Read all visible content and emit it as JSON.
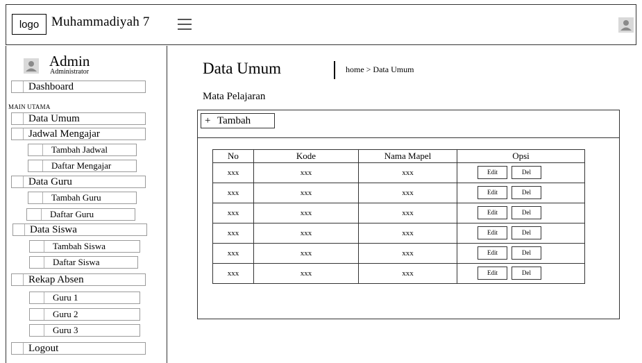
{
  "header": {
    "logo_label": "logo",
    "school_name": "Muhammadiyah 7",
    "menu_icon": "hamburger-icon",
    "user_icon": "user-icon"
  },
  "sidebar": {
    "user": {
      "name": "Admin",
      "role": "Administrator",
      "icon": "user-icon"
    },
    "dashboard": "Dashboard",
    "section_label": "MAIN UTAMA",
    "data_umum": "Data Umum",
    "jadwal_mengajar": "Jadwal Mengajar",
    "tambah_jadwal": "Tambah Jadwal",
    "daftar_mengajar": "Daftar Mengajar",
    "data_guru": "Data Guru",
    "tambah_guru": "Tambah Guru",
    "daftar_guru": "Daftar Guru",
    "data_siswa": "Data Siswa",
    "tambah_siswa": "Tambah Siswa",
    "daftar_siswa": "Daftar Siswa",
    "rekap_absen": "Rekap Absen",
    "guru_1": "Guru 1",
    "guru_2": "Guru 2",
    "guru_3": "Guru 3",
    "logout": "Logout"
  },
  "main": {
    "title": "Data Umum",
    "breadcrumb": "home > Data Umum",
    "subtitle": "Mata Pelajaran",
    "add_button": {
      "icon": "+",
      "label": "Tambah"
    },
    "table": {
      "headers": [
        "No",
        "Kode",
        "Nama Mapel",
        "Opsi"
      ],
      "edit_label": "Edit",
      "del_label": "Del",
      "rows": [
        [
          "xxx",
          "xxx",
          "xxx"
        ],
        [
          "xxx",
          "xxx",
          "xxx"
        ],
        [
          "xxx",
          "xxx",
          "xxx"
        ],
        [
          "xxx",
          "xxx",
          "xxx"
        ],
        [
          "xxx",
          "xxx",
          "xxx"
        ],
        [
          "xxx",
          "xxx",
          "xxx"
        ]
      ]
    }
  },
  "colors": {
    "border": "#333333",
    "placeholder_gray": "#d9d9d9",
    "background": "#ffffff"
  }
}
